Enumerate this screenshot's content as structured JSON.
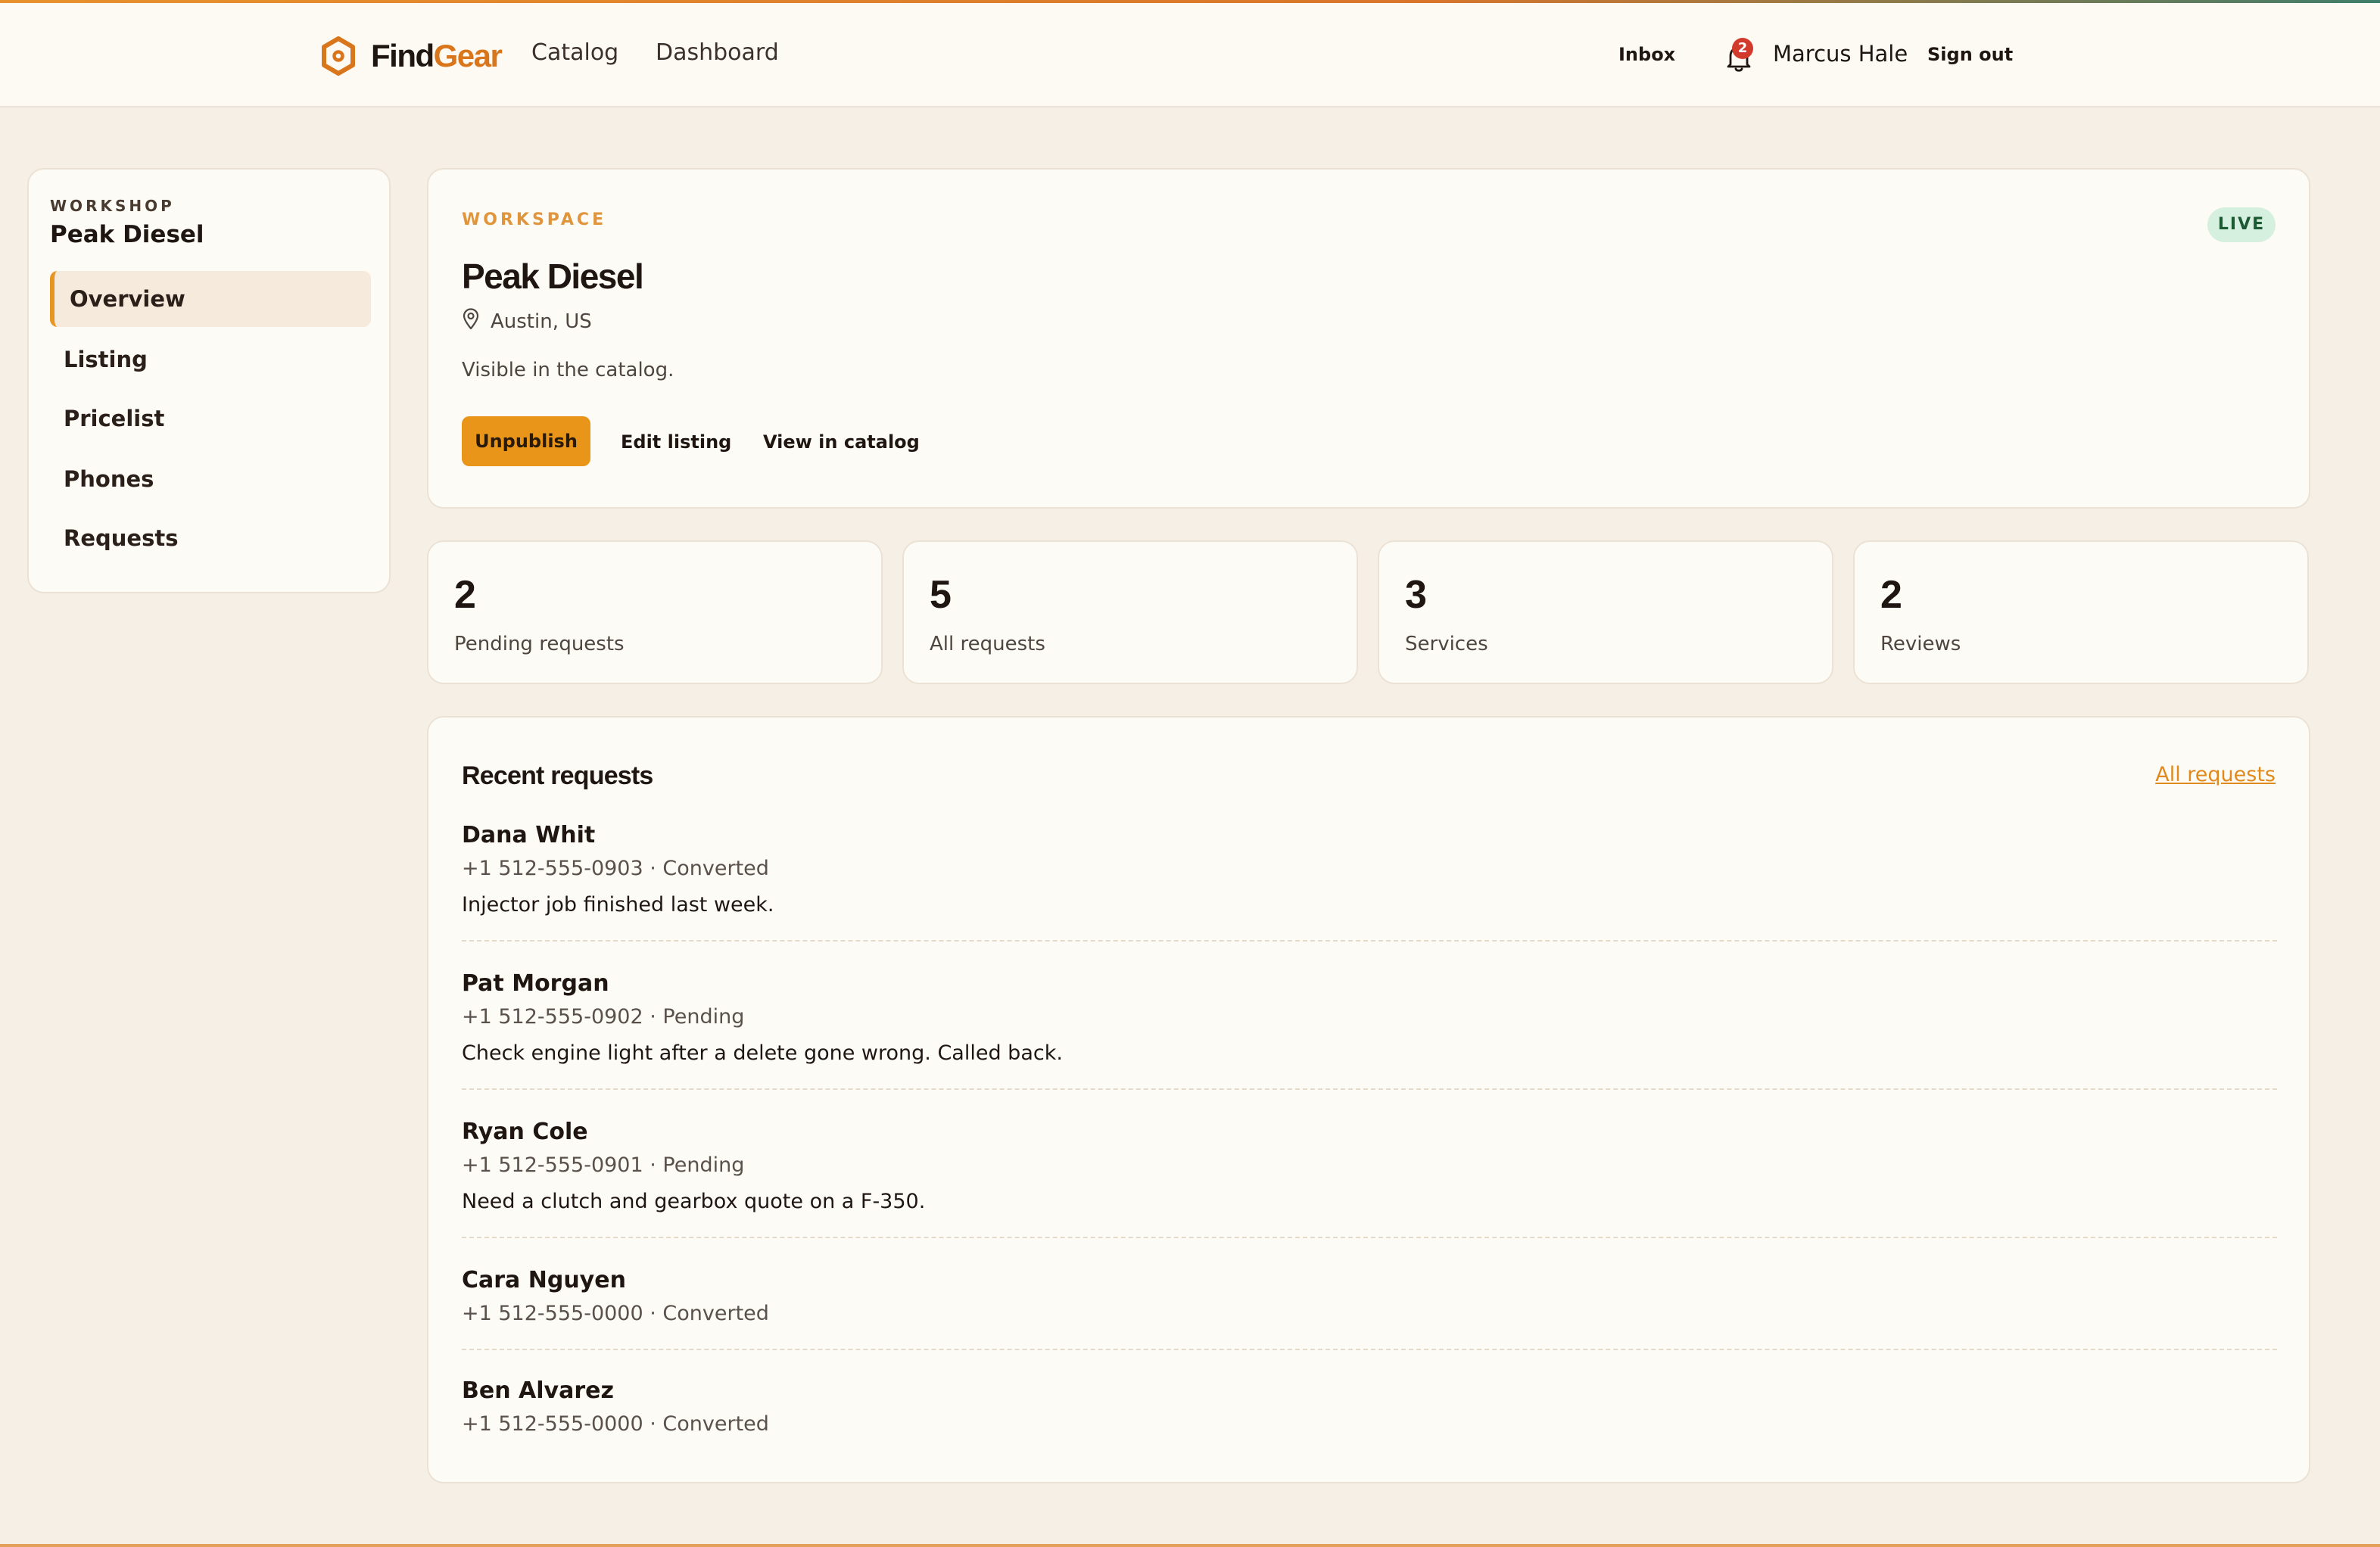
{
  "header": {
    "logo": {
      "find": "Find",
      "gear": "Gear",
      "icon": "hexagon-logo-icon"
    },
    "nav": [
      {
        "label": "Catalog"
      },
      {
        "label": "Dashboard"
      }
    ],
    "inbox_label": "Inbox",
    "notification_count": "2",
    "user_name": "Marcus Hale",
    "signout_label": "Sign out"
  },
  "sidebar": {
    "kicker": "WORKSHOP",
    "title": "Peak Diesel",
    "items": [
      {
        "label": "Overview",
        "active": true
      },
      {
        "label": "Listing"
      },
      {
        "label": "Pricelist"
      },
      {
        "label": "Phones"
      },
      {
        "label": "Requests"
      }
    ]
  },
  "workspace": {
    "kicker": "WORKSPACE",
    "title": "Peak Diesel",
    "location": "Austin, US",
    "description": "Visible in the catalog.",
    "status_badge": "LIVE",
    "actions": {
      "unpublish": "Unpublish",
      "edit": "Edit listing",
      "view": "View in catalog"
    }
  },
  "stats": [
    {
      "value": "2",
      "label": "Pending requests"
    },
    {
      "value": "5",
      "label": "All requests"
    },
    {
      "value": "3",
      "label": "Services"
    },
    {
      "value": "2",
      "label": "Reviews"
    }
  ],
  "recent": {
    "title": "Recent requests",
    "all_link": "All requests",
    "items": [
      {
        "name": "Dana Whit",
        "meta": "+1 512-555-0903 · Converted",
        "note": "Injector job finished last week."
      },
      {
        "name": "Pat Morgan",
        "meta": "+1 512-555-0902 · Pending",
        "note": "Check engine light after a delete gone wrong. Called back."
      },
      {
        "name": "Ryan Cole",
        "meta": "+1 512-555-0901 · Pending",
        "note": "Need a clutch and gearbox quote on a F-350."
      },
      {
        "name": "Cara Nguyen",
        "meta": "+1 512-555-0000 · Converted",
        "note": ""
      },
      {
        "name": "Ben Alvarez",
        "meta": "+1 512-555-0000 · Converted",
        "note": ""
      }
    ]
  },
  "colors": {
    "accent": "#e8951a",
    "brand_orange": "#d9761c",
    "live_bg": "#d6f0df",
    "live_text": "#1c5a34",
    "badge_red": "#d23a2b"
  }
}
